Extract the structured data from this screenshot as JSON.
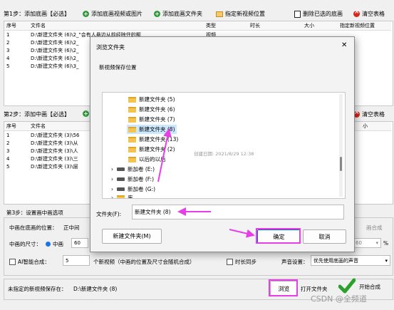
{
  "step1": {
    "label": "第1步：添加底画【必选】",
    "add_media": "添加底画视频或图片",
    "add_folder": "添加底画文件夹",
    "set_position": "指定新视频位置",
    "delete_selected": "删除已选的底画",
    "clear_table": "清空表格",
    "columns": [
      "序号",
      "文件名",
      "类型",
      "时长",
      "大小",
      "指定新视频位置"
    ],
    "rows": [
      {
        "index": "1",
        "file": "D:\\新建文件夹 (6)\\2_\"会有人悬边从前经除住的柳",
        "type": "视频"
      },
      {
        "index": "2",
        "file": "D:\\新建文件夹 (6)\\2_",
        "type": ""
      },
      {
        "index": "3",
        "file": "D:\\新建文件夹 (6)\\2_",
        "type": ""
      },
      {
        "index": "4",
        "file": "D:\\新建文件夹 (6)\\2_",
        "type": ""
      },
      {
        "index": "5",
        "file": "D:\\新建文件夹 (6)\\3_",
        "type": ""
      }
    ]
  },
  "step2": {
    "label": "第2步：添加中画【必选】",
    "clear_table": "清空表格",
    "columns": [
      "序号",
      "文件名",
      "小"
    ],
    "rows": [
      {
        "index": "1",
        "file": "D:\\新建文件夹 (3)\\56"
      },
      {
        "index": "2",
        "file": "D:\\新建文件夹 (3)\\从"
      },
      {
        "index": "3",
        "file": "D:\\新建文件夹 (3)\\人"
      },
      {
        "index": "4",
        "file": "D:\\新建文件夹 (3)\\三"
      },
      {
        "index": "5",
        "file": "D:\\新建文件夹 (3)\\层"
      }
    ]
  },
  "step3": {
    "label": "第3步：设置画中画选项",
    "position_label": "中画在底画的位置：",
    "position_value": "正中间",
    "size_label": "中画的尺寸：",
    "size_option": "中画",
    "size_value": "60",
    "ai_label": "AI智能合成：",
    "ai_value": "5",
    "ai_suffix": "个新视频（中画的位置及尺寸会随机合成）",
    "sync_label": "时长同步",
    "audio_label": "声音设置：",
    "audio_value": "优先使用底画的声音",
    "blend_label": "画合成",
    "percent_value": "60",
    "percent_unit": "%"
  },
  "output": {
    "label": "未指定的新视频保存在：",
    "path": "D:\\新建文件夹 (8)",
    "browse": "浏览",
    "open_folder": "打开文件夹",
    "start": "开始合成",
    "watermark": "CSDN @全频道"
  },
  "dialog": {
    "title": "浏览文件夹",
    "subtitle": "新视频保存位置",
    "close": "✕",
    "tree": [
      {
        "label": "新建文件夹 (5)",
        "kind": "folder"
      },
      {
        "label": "新建文件夹 (6)",
        "kind": "folder"
      },
      {
        "label": "新建文件夹 (7)",
        "kind": "folder"
      },
      {
        "label": "新建文件夹 (8)",
        "kind": "folder",
        "selected": true
      },
      {
        "label": "新建文件夹 (13)",
        "kind": "folder"
      },
      {
        "label": "新建文件夹 (2)",
        "kind": "folder"
      },
      {
        "label": "以后的以后",
        "kind": "folder"
      },
      {
        "label": "新加卷 (E:)",
        "kind": "drive"
      },
      {
        "label": "新加卷 (F:)",
        "kind": "drive"
      },
      {
        "label": "新加卷 (G:)",
        "kind": "drive"
      },
      {
        "label": "库",
        "kind": "lib"
      }
    ],
    "tooltip": "创建日期: 2021/8/29 12:38",
    "folder_label": "文件夹(F):",
    "folder_value": "新建文件夹 (8)",
    "new_folder": "新建文件夹(M)",
    "ok": "确定",
    "cancel": "取消"
  },
  "colors": {
    "highlight": "#e83ee8",
    "selection": "#cce8ff",
    "accent": "#1a73e8"
  }
}
